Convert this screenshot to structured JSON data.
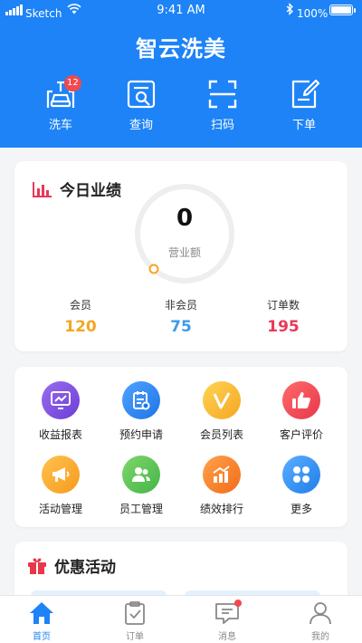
{
  "status_bar": {
    "carrier": "Sketch",
    "time": "9:41 AM",
    "battery": "100%"
  },
  "app_title": "智云洗美",
  "quick_actions": [
    {
      "label": "洗车",
      "icon": "car-wash-icon",
      "badge": "12"
    },
    {
      "label": "查询",
      "icon": "search-document-icon"
    },
    {
      "label": "扫码",
      "icon": "scan-icon"
    },
    {
      "label": "下单",
      "icon": "edit-order-icon"
    }
  ],
  "today": {
    "title": "今日业绩",
    "revenue_value": "0",
    "revenue_label": "营业额",
    "revenue_progress": 0,
    "stats": [
      {
        "label": "会员",
        "value": "120",
        "color": "#f5a623"
      },
      {
        "label": "非会员",
        "value": "75",
        "color": "#3d9be9"
      },
      {
        "label": "订单数",
        "value": "195",
        "color": "#e8375a"
      }
    ]
  },
  "menu": [
    {
      "label": "收益报表",
      "icon": "chart-icon",
      "color": "#7b4fe0"
    },
    {
      "label": "预约申请",
      "icon": "appointment-icon",
      "color": "#2f86f0"
    },
    {
      "label": "会员列表",
      "icon": "vip-icon",
      "color": "#f7b731"
    },
    {
      "label": "客户评价",
      "icon": "thumbs-up-icon",
      "color": "#f0494f"
    },
    {
      "label": "活动管理",
      "icon": "megaphone-icon",
      "color": "#f7a531"
    },
    {
      "label": "员工管理",
      "icon": "staff-icon",
      "color": "#5cc25b"
    },
    {
      "label": "绩效排行",
      "icon": "performance-icon",
      "color": "#f7841f"
    },
    {
      "label": "更多",
      "icon": "more-icon",
      "color": "#3593f2"
    }
  ],
  "promo": {
    "title": "优惠活动"
  },
  "tabs": [
    {
      "label": "首页",
      "icon": "home-icon",
      "active": true
    },
    {
      "label": "订单",
      "icon": "order-icon"
    },
    {
      "label": "消息",
      "icon": "message-icon",
      "dot": true
    },
    {
      "label": "我的",
      "icon": "profile-icon"
    }
  ],
  "colors": {
    "primary": "#1d83f7",
    "background": "#f4f5f7"
  }
}
